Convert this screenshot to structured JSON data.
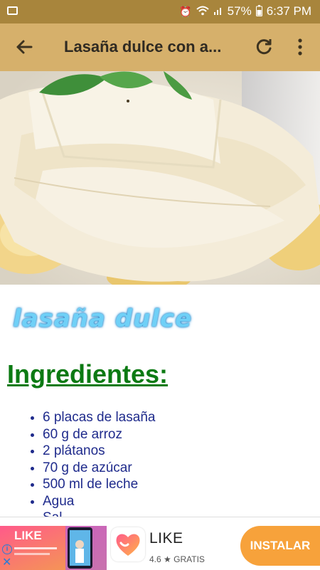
{
  "status_bar": {
    "battery": "57%",
    "time": "6:37 PM"
  },
  "toolbar": {
    "title": "Lasaña dulce con a..."
  },
  "content": {
    "logo_text": "lasaña dulce",
    "heading": "Ingredientes:",
    "ingredients": [
      "6 placas de lasaña",
      "60 g de arroz",
      "2 plátanos",
      "70 g de azúcar",
      "500 ml de leche",
      "Agua",
      "Sal"
    ]
  },
  "ad": {
    "banner_brand": "LIKE",
    "app_name": "LIKE",
    "rating": "4.6",
    "price": "GRATIS",
    "install_label": "INSTALAR"
  },
  "colors": {
    "status_bar": "#a8853c",
    "toolbar": "#d6b06b",
    "heading": "#0c7a13",
    "ingredient_text": "#1f2b8c",
    "install_button": "#f7a23b"
  }
}
